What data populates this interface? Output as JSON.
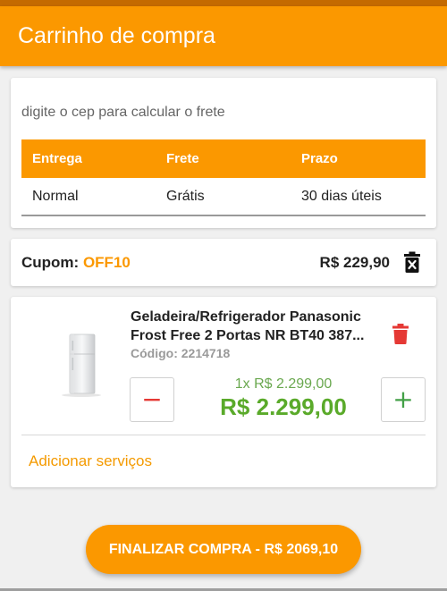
{
  "header": {
    "title": "Carrinho de compra"
  },
  "shipping": {
    "cep_placeholder": "digite o cep para calcular o frete",
    "columns": [
      "Entrega",
      "Frete",
      "Prazo"
    ],
    "rows": [
      {
        "delivery": "Normal",
        "freight": "Grátis",
        "deadline": "30 dias úteis"
      }
    ]
  },
  "coupon": {
    "label": "Cupom:",
    "code": "OFF10",
    "value": "R$ 229,90",
    "remove_icon": "trash-icon"
  },
  "item": {
    "name": "Geladeira/Refrigerador Panasonic Frost Free 2 Portas NR BT40 387...",
    "code": "Código: 2214718",
    "unit_price": "1x R$ 2.299,00",
    "total_price": "R$ 2.299,00",
    "quantity": 1,
    "minus_symbol": "−",
    "plus_symbol": "+",
    "add_services": "Adicionar serviços",
    "image": "refrigerator-image"
  },
  "checkout": {
    "label": "FINALIZAR COMPRA - R$ 2069,10"
  },
  "colors": {
    "primary": "#fb9800",
    "price_green": "#5aaa2a",
    "delete_red": "#e53935"
  }
}
